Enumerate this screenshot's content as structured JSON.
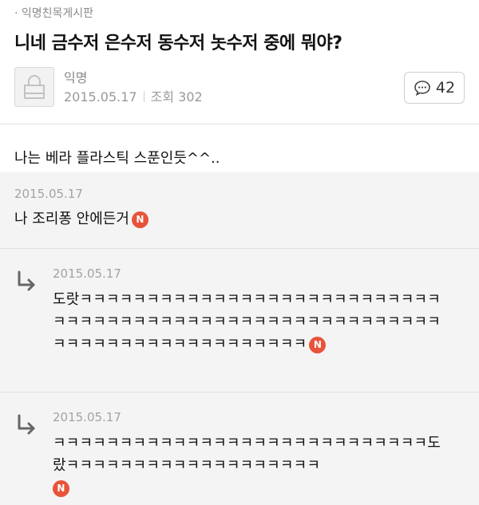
{
  "board": "· 익명친목게시판",
  "post": {
    "title": "니네 금수저 은수저 동수저 놋수저 중에 뭐야?",
    "author": "익명",
    "date": "2015.05.17",
    "views": "조회 302",
    "comment_count": "42",
    "body": "나는 베라 플라스틱 스푼인듯^^.."
  },
  "comments": [
    {
      "date": "2015.05.17",
      "text": "나 조리퐁 안에든거",
      "badge": "N"
    }
  ],
  "replies": [
    {
      "date": "2015.05.17",
      "text": "도랏ㅋㅋㅋㅋㅋㅋㅋㅋㅋㅋㅋㅋㅋㅋㅋㅋㅋㅋㅋㅋㅋㅋㅋㅋㅋㅋㅋㅋㅋㅋㅋㅋㅋㅋㅋㅋㅋㅋㅋㅋㅋㅋㅋㅋㅋㅋㅋㅋㅋㅋㅋㅋㅋㅋㅋㅋㅋㅋㅋㅋㅋㅋㅋㅋㅋㅋㅋㅋㅋㅋㅋㅋㅋㅋㅋ",
      "badge": "N"
    },
    {
      "date": "2015.05.17",
      "text": "ㅋㅋㅋㅋㅋㅋㅋㅋㅋㅋㅋㅋㅋㅋㅋㅋㅋㅋㅋㅋㅋㅋㅋㅋㅋㅋㅋㅋ도랐ㅋㅋㅋㅋㅋㅋㅋㅋㅋㅋㅋㅋㅋㅋㅋㅋㅋㅋㅋ",
      "badge": "N"
    }
  ],
  "icons": {
    "avatar": "lock-icon",
    "comment": "speech-bubble-icon",
    "reply": "reply-arrow-icon"
  },
  "colors": {
    "badge": "#e8533a",
    "comments_bg": "#f4f4f4"
  }
}
